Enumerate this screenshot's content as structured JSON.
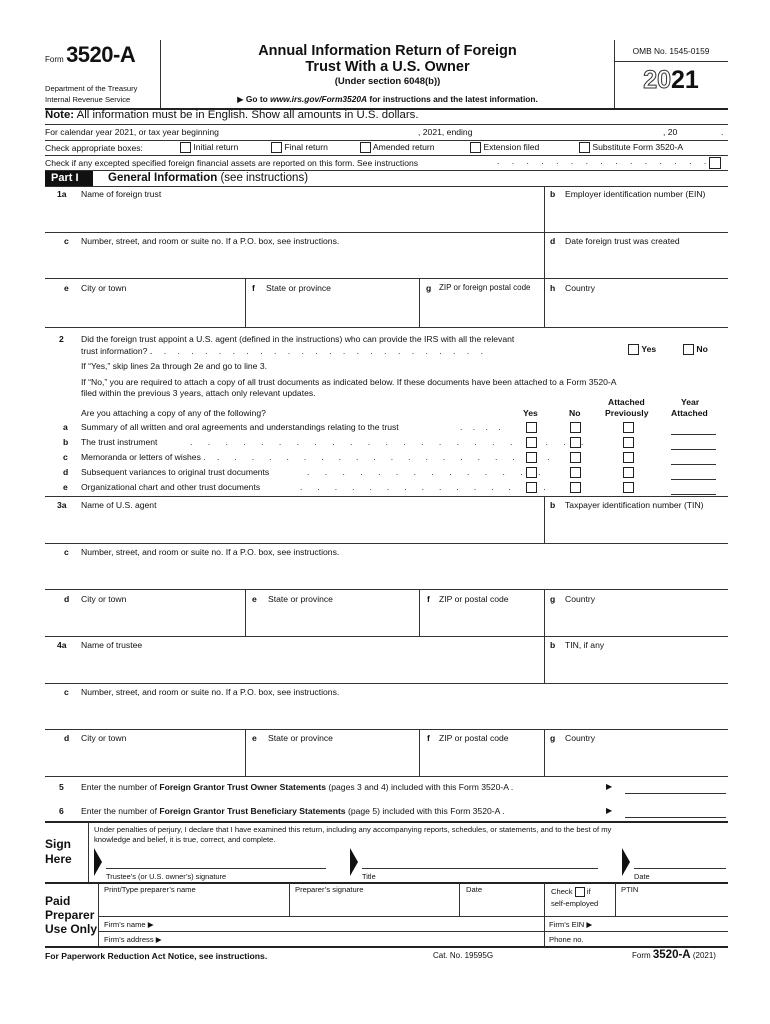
{
  "header": {
    "form_word": "Form",
    "form_number": "3520-A",
    "department": "Department of the Treasury",
    "service": "Internal Revenue Service",
    "title_line1": "Annual Information Return of Foreign",
    "title_line2": "Trust With a U.S. Owner",
    "subtitle": "(Under section 6048(b))",
    "goto_prefix": "▶ Go to ",
    "goto_url": "www.irs.gov/Form3520A",
    "goto_suffix": " for instructions and the latest information.",
    "omb": "OMB No. 1545-0159",
    "year_outline": "20",
    "year_bold": "21"
  },
  "note": {
    "label": "Note:",
    "text": " All information must be in English. Show all amounts in U.S. dollars."
  },
  "tax_year": {
    "prefix": "For calendar year 2021, or tax year beginning",
    "middle": ", 2021, ending",
    "suffix": ", 20",
    "end": "."
  },
  "check_boxes": {
    "label": "Check appropriate boxes:",
    "options": [
      "Initial return",
      "Final return",
      "Amended return",
      "Extension filed",
      "Substitute Form 3520-A"
    ]
  },
  "excepted_assets": {
    "text": "Check if any excepted specified foreign financial assets are reported on this form. See instructions",
    "dots": ". . . . . . . . . . . . . . ."
  },
  "part1": {
    "badge": "Part I",
    "title": "General Information",
    "title_suffix": " (see instructions)",
    "line1": {
      "a_num": "1a",
      "a_label": "Name of foreign trust",
      "b_num": "b",
      "b_label": "Employer identification number (EIN)",
      "c_num": "c",
      "c_label": "Number, street, and room or suite no. If a P.O. box, see instructions.",
      "d_num": "d",
      "d_label": "Date foreign trust was created",
      "e_num": "e",
      "e_label": "City or town",
      "f_num": "f",
      "f_label": "State or province",
      "g_num": "g",
      "g_label": "ZIP or foreign postal code",
      "h_num": "h",
      "h_label": "Country"
    },
    "line2": {
      "num": "2",
      "question_l1": "Did the foreign trust appoint a U.S. agent (defined in the instructions) who can provide the IRS with all the relevant",
      "question_l2": "trust information? .",
      "dots": ". . . . . . . . . . . . . . . . . . . . . . . . .",
      "yes": "Yes",
      "no": "No",
      "if_yes": "If “Yes,” skip lines 2a through 2e and go to line 3.",
      "if_no_l1": "If “No,” you are required to attach a copy of all trust documents as indicated below. If these documents have been attached to a Form 3520-A",
      "if_no_l2": "filed within the previous 3 years, attach only relevant updates.",
      "question_attach": "Are you attaching a copy of any of the following?",
      "col_yes": "Yes",
      "col_no": "No",
      "col_attached_l1": "Attached",
      "col_attached_l2": "Previously",
      "col_year_l1": "Year",
      "col_year_l2": "Attached",
      "items": [
        {
          "letter": "a",
          "label": "Summary of all written and oral agreements and understandings relating to the trust",
          "dots": ". . . ."
        },
        {
          "letter": "b",
          "label": "The trust instrument",
          "dots": ". . . . . . . . . . . . . . . . . . . . . . ."
        },
        {
          "letter": "c",
          "label": "Memoranda or letters of wishes .",
          "dots": ". . . . . . . . . . . . . . . . . . . ."
        },
        {
          "letter": "d",
          "label": "Subsequent variances to original trust documents",
          "dots": ". . . . . . . . . . . . . ."
        },
        {
          "letter": "e",
          "label": "Organizational chart and other trust documents",
          "dots": ". . . . . . . . . . . . . . ."
        }
      ]
    },
    "line3": {
      "a_num": "3a",
      "a_label": "Name of U.S. agent",
      "b_num": "b",
      "b_label": "Taxpayer identification number (TIN)",
      "c_num": "c",
      "c_label": "Number, street, and room or suite no. If a P.O. box, see instructions.",
      "d_num": "d",
      "d_label": "City or town",
      "e_num": "e",
      "e_label": "State or province",
      "f_num": "f",
      "f_label": "ZIP or postal code",
      "g_num": "g",
      "g_label": "Country"
    },
    "line4": {
      "a_num": "4a",
      "a_label": "Name of trustee",
      "b_num": "b",
      "b_label": "TIN, if any",
      "c_num": "c",
      "c_label": "Number, street, and room or suite no. If a P.O. box, see instructions.",
      "d_num": "d",
      "d_label": "City or town",
      "e_num": "e",
      "e_label": "State or province",
      "f_num": "f",
      "f_label": "ZIP or postal code",
      "g_num": "g",
      "g_label": "Country"
    },
    "line5": {
      "num": "5",
      "prefix": "Enter the number of ",
      "bold": "Foreign Grantor Trust Owner Statements",
      "suffix": " (pages 3 and 4) included with this Form 3520-A .",
      "arrow": "▶"
    },
    "line6": {
      "num": "6",
      "prefix": "Enter the number of ",
      "bold": "Foreign Grantor Trust Beneficiary Statements",
      "suffix": " (page 5) included with this Form 3520-A   .",
      "arrow": "▶"
    }
  },
  "sign": {
    "label_l1": "Sign",
    "label_l2": "Here",
    "declaration_l1": "Under penalties of perjury, I declare that I have examined this return, including any accompanying reports, schedules, or statements, and to the best of my",
    "declaration_l2": "knowledge and belief, it is true, correct, and complete.",
    "sig_label": "Trustee’s (or U.S. owner’s) signature",
    "title_label": "Title",
    "date_label": "Date"
  },
  "preparer": {
    "label_l1": "Paid",
    "label_l2": "Preparer",
    "label_l3": "Use Only",
    "name_label": "Print/Type preparer’s name",
    "sig_label": "Preparer’s signature",
    "date_label": "Date",
    "check_label": "Check",
    "check_if": "if",
    "self_employed": "self-employed",
    "ptin_label": "PTIN",
    "firm_name_label": "Firm’s name ▶",
    "firm_ein_label": "Firm’s EIN ▶",
    "firm_address_label": "Firm’s address ▶",
    "phone_label": "Phone no."
  },
  "footer": {
    "paperwork": "For Paperwork Reduction Act Notice, see instructions.",
    "cat_no": "Cat. No. 19595G",
    "form_word": "Form ",
    "form_number": "3520-A",
    "form_year": " (2021)"
  }
}
